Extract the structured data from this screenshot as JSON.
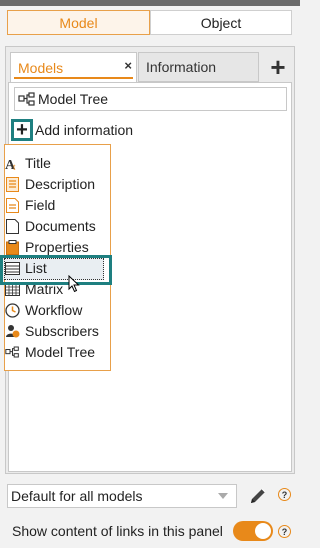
{
  "segments": {
    "model": "Model",
    "object": "Object"
  },
  "tabs": {
    "models": "Models",
    "models_close": "×",
    "information": "Information",
    "add": "+"
  },
  "tree_field": {
    "value": "Model Tree"
  },
  "add_information": {
    "label": "Add information"
  },
  "menu": {
    "items": [
      {
        "label": "Title",
        "icon": "title-icon"
      },
      {
        "label": "Description",
        "icon": "description-icon"
      },
      {
        "label": "Field",
        "icon": "field-icon"
      },
      {
        "label": "Documents",
        "icon": "documents-icon"
      },
      {
        "label": "Properties",
        "icon": "properties-icon"
      },
      {
        "label": "List",
        "icon": "list-icon",
        "highlighted": true
      },
      {
        "label": "Matrix",
        "icon": "matrix-icon"
      },
      {
        "label": "Workflow",
        "icon": "workflow-icon"
      },
      {
        "label": "Subscribers",
        "icon": "subscribers-icon"
      },
      {
        "label": "Model Tree",
        "icon": "model-tree-icon"
      }
    ]
  },
  "bottom": {
    "select_value": "Default for all models",
    "show_links_label": "Show content of links in this panel",
    "toggle_on": true,
    "help_glyph": "?"
  },
  "colors": {
    "accent": "#e8891a",
    "highlight": "#1e7f80"
  }
}
